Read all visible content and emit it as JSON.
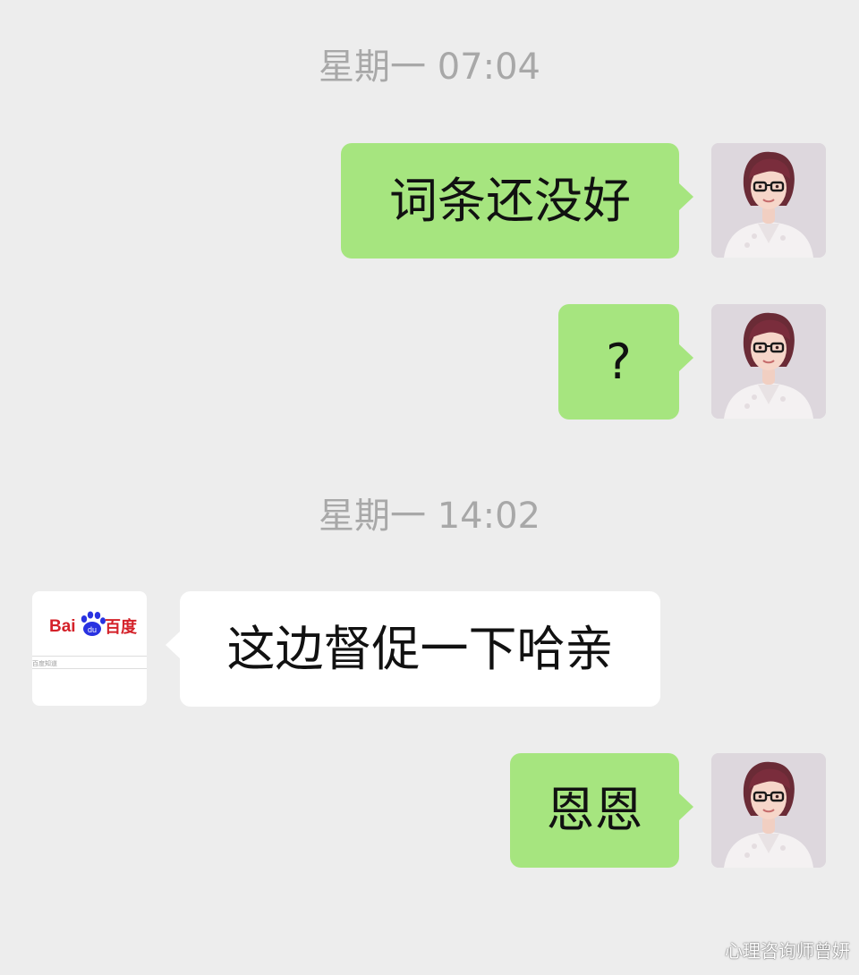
{
  "conversation": {
    "timestamps": [
      "星期一 07:04",
      "星期一 14:02"
    ],
    "messages": [
      {
        "side": "sent",
        "text": "词条还没好"
      },
      {
        "side": "sent",
        "text": "?"
      },
      {
        "side": "received",
        "text": "这边督促一下哈亲"
      },
      {
        "side": "sent",
        "text": "恩恩"
      }
    ]
  },
  "baidu_avatar": {
    "logo_prefix": "Bai",
    "logo_paw_text": "du",
    "logo_suffix": "百度",
    "small_text": "百度知道"
  },
  "watermark": "心理咨询师曾妍",
  "colors": {
    "background": "#ededed",
    "sent_bubble": "#a6e57f",
    "received_bubble": "#ffffff",
    "timestamp": "#a8a8a8",
    "baidu_red": "#d42129",
    "baidu_blue": "#2932e1"
  }
}
